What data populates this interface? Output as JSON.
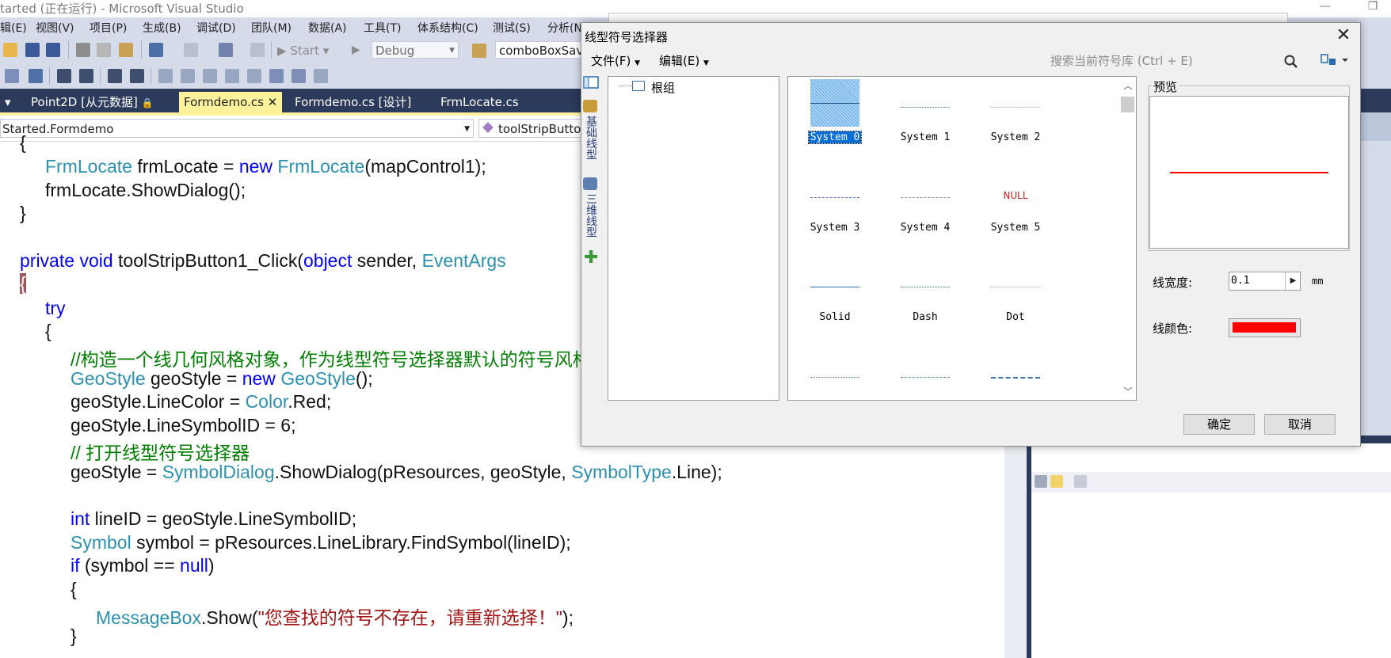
{
  "vs": {
    "title": "tarted (正在运行) - Microsoft Visual Studio",
    "menu": [
      "辑(E)",
      "视图(V)",
      "项目(P)",
      "生成(B)",
      "调试(D)",
      "团队(M)",
      "数据(A)",
      "工具(T)",
      "体系结构(C)",
      "测试(S)",
      "分析(N"
    ],
    "toolbar": {
      "start_label": "Start",
      "config": "Debug",
      "target": "comboBoxSave"
    },
    "tabs": [
      {
        "label": "Point2D [从元数据]"
      },
      {
        "label": "Formdemo.cs",
        "active": true
      },
      {
        "label": "Formdemo.cs [设计]"
      },
      {
        "label": "FrmLocate.cs"
      }
    ],
    "nav": {
      "class": "Started.Formdemo",
      "member": "toolStripButto"
    },
    "code_lines": [
      "{",
      "FrmLocate frmLocate = new FrmLocate(mapControl1);",
      "frmLocate.ShowDialog();",
      "}",
      "",
      "private void toolStripButton1_Click(object sender, EventArgs",
      "{",
      "try",
      "{",
      "//构造一个线几何风格对象，作为线型符号选择器默认的符号风格",
      "GeoStyle geoStyle = new GeoStyle();",
      "geoStyle.LineColor = Color.Red;",
      "geoStyle.LineSymbolID = 6;",
      "// 打开线型符号选择器",
      "geoStyle = SymbolDialog.ShowDialog(pResources, geoStyle, SymbolType.Line);",
      "",
      "int lineID = geoStyle.LineSymbolID;",
      "Symbol symbol = pResources.LineLibrary.FindSymbol(lineID);",
      "if (symbol == null)",
      "{",
      "MessageBox.Show(\"您查找的符号不存在，请重新选择！\");",
      "}"
    ]
  },
  "dialog": {
    "title": "线型符号选择器",
    "menu_file": "文件(F)",
    "menu_edit": "编辑(E)",
    "search_placeholder": "搜索当前符号库 (Ctrl + E)",
    "sidebar": [
      "基础线型",
      "三维线型"
    ],
    "tree_root": "根组",
    "symbols": [
      {
        "label": "System 0",
        "style": "hatch",
        "selected": true
      },
      {
        "label": "System 1",
        "style": "dotted-blue"
      },
      {
        "label": "System 2",
        "style": "dotted-light"
      },
      {
        "label": "System 3",
        "style": "dashdot-blue"
      },
      {
        "label": "System 4",
        "style": "dashdot-blue2"
      },
      {
        "label": "System 5",
        "style": "null"
      },
      {
        "label": "Solid",
        "style": "solid"
      },
      {
        "label": "Dash",
        "style": "dotted-blue"
      },
      {
        "label": "Dot",
        "style": "dotted-light"
      },
      {
        "label": "",
        "style": "dotted-blue"
      },
      {
        "label": "",
        "style": "dashdot-blue"
      },
      {
        "label": "",
        "style": "dash-long"
      }
    ],
    "null_text": "NULL",
    "preview_label": "预览",
    "width_label": "线宽度:",
    "width_value": "0.1",
    "width_unit": "mm",
    "color_label": "线颜色:",
    "line_color": "#ff0000",
    "ok_label": "确定",
    "cancel_label": "取消"
  }
}
